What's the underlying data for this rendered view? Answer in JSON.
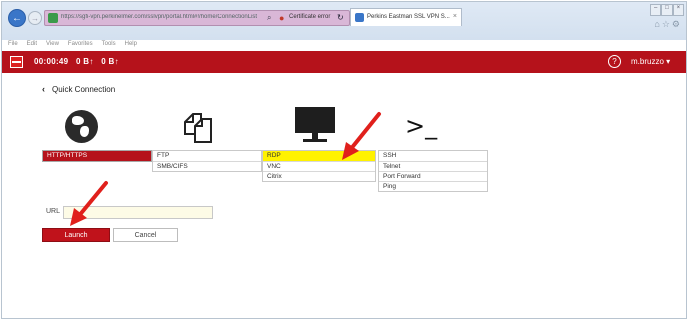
{
  "browser": {
    "url": "https://sgfi-vpn.perkinelmer.com/sslvpn/portal.html#!/home/ConnectionList",
    "certificate_label": "Certificate error",
    "tab_title": "Perkins Eastman SSL VPN S...",
    "menu": [
      "File",
      "Edit",
      "View",
      "Favorites",
      "Tools",
      "Help"
    ]
  },
  "appbar": {
    "session_time": "00:00:49",
    "bytes_in": "0 B",
    "bytes_out": "0 B",
    "user": "m.bruzzo"
  },
  "quick_connection": {
    "title": "Quick Connection",
    "columns": [
      {
        "icon": "globe-icon",
        "items": [
          "HTTP/HTTPS"
        ]
      },
      {
        "icon": "files-icon",
        "items": [
          "FTP",
          "SMB/CIFS"
        ]
      },
      {
        "icon": "monitor-icon",
        "items": [
          "RDP",
          "VNC",
          "Citrix"
        ]
      },
      {
        "icon": "terminal-icon",
        "items": [
          "SSH",
          "Telnet",
          "Port Forward",
          "Ping"
        ]
      }
    ],
    "selected": "HTTP/HTTPS",
    "highlighted": "RDP",
    "terminal_glyph": ">_"
  },
  "form": {
    "url_label": "URL",
    "url_value": "",
    "launch_label": "Launch",
    "cancel_label": "Cancel"
  },
  "colors": {
    "brand_red": "#b5121b",
    "highlight_yellow": "#fff200",
    "arrow_red": "#e0201c"
  }
}
